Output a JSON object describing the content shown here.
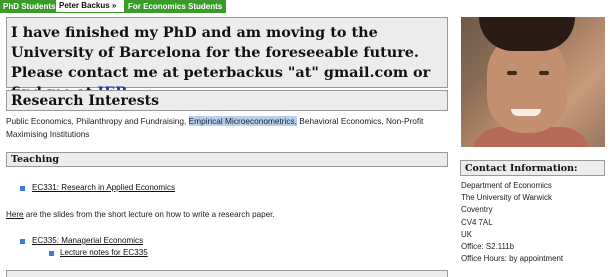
{
  "nav": {
    "tabs": [
      {
        "label": "PhD Students »"
      },
      {
        "label": "Peter Backus »"
      },
      {
        "label": "For Economics Students"
      }
    ]
  },
  "announcement": {
    "text_before": "I have finished my PhD and am moving to the University of Barcelona for the foreseeable future. Please contact me at peterbackus \"at\" gmail.com or find me at ",
    "link": "IEB",
    "text_after": "."
  },
  "research": {
    "heading": "Research Interests",
    "before_highlight": "Public Economics, Philanthropy and Fundraising, ",
    "highlight": "Empirical Microeconometrics,",
    "after_highlight": " Behavioral Economics, Non-Profit Maximising Institutions"
  },
  "teaching": {
    "heading": "Teaching",
    "course1": "EC331: Research in Applied Economics",
    "slides_link": "Here",
    "slides_text": " are the slides from the short lecture on how to write a research paper.",
    "course2": "EC335: Managerial Economics",
    "course2_sub": "Lecture notes for EC335"
  },
  "contact": {
    "heading": "Contact Information:",
    "lines": [
      "Department of Economics",
      "The University of Warwick",
      "Coventry",
      "CV4 7AL",
      "UK",
      "Office: S2.111b",
      "Office Hours: by appointment"
    ]
  },
  "colors": {
    "nav_green": "#3a9b2b",
    "box_bg": "#ececec",
    "bullet": "#3a7bd5",
    "link_blue": "#1a2fa8"
  },
  "icons": {
    "bullet": "square-bullet-icon"
  }
}
